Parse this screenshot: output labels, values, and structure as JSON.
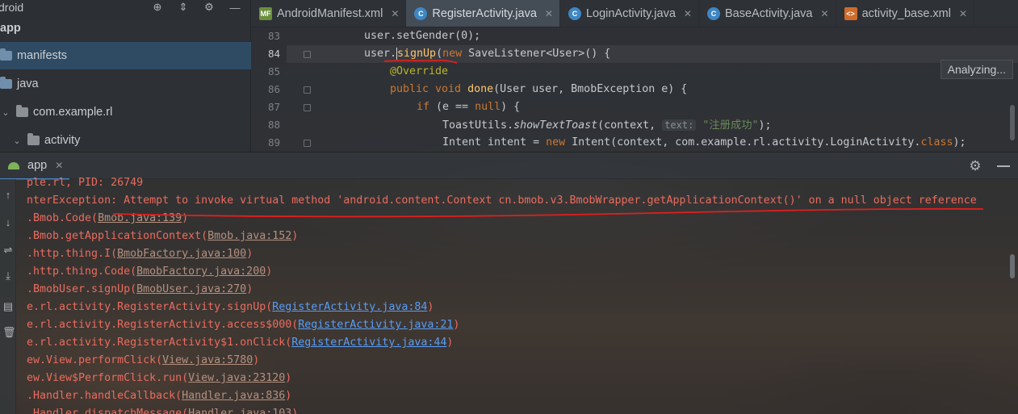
{
  "project": {
    "header": "droid",
    "items": [
      {
        "label": "app",
        "selected": false
      },
      {
        "label": "manifests",
        "selected": true
      },
      {
        "label": "java",
        "selected": false
      },
      {
        "label": "com.example.rl",
        "selected": false
      },
      {
        "label": "activity",
        "selected": false
      }
    ]
  },
  "editor": {
    "tabs": [
      {
        "label": "AndroidManifest.xml",
        "icon": "manifest-icon",
        "active": false
      },
      {
        "label": "RegisterActivity.java",
        "icon": "class-icon",
        "active": true
      },
      {
        "label": "LoginActivity.java",
        "icon": "class-icon",
        "active": false
      },
      {
        "label": "BaseActivity.java",
        "icon": "class-icon",
        "active": false
      },
      {
        "label": "activity_base.xml",
        "icon": "xml-icon",
        "active": false
      }
    ],
    "line_numbers": [
      "83",
      "84",
      "85",
      "86",
      "87",
      "88",
      "89"
    ],
    "current_line": "84",
    "code": {
      "l83": "user.setGender(0);",
      "l84_a": "user.",
      "l84_b": "signUp",
      "l84_c": "(",
      "l84_kw": "new",
      "l84_d": " SaveListener<User>() {",
      "l85": "@Override",
      "l86_kw": "public void",
      "l86_fn": "done",
      "l86_rest": "(User user, BmobException e) {",
      "l87_kw": "if",
      "l87_a": " (e == ",
      "l87_null": "null",
      "l87_b": ") {",
      "l88_a": "ToastUtils.",
      "l88_fn": "showTextToast",
      "l88_b": "(context, ",
      "l88_hint": "text:",
      "l88_str": "\"注册成功\"",
      "l88_c": ");",
      "l89_a": "Intent intent = ",
      "l89_kw": "new",
      "l89_b": " Intent(context, com.example.rl.activity.LoginActivity.",
      "l89_cls": "class",
      "l89_c": ");"
    },
    "status": "Analyzing..."
  },
  "run": {
    "tab_label": "app",
    "lines": [
      {
        "text": "ple.rl, PID: 26749",
        "link": "",
        "after": "",
        "blue": false
      },
      {
        "text": "nterException: Attempt to invoke virtual method 'android.content.Context cn.bmob.v3.BmobWrapper.getApplicationContext()' on a null object reference",
        "link": "",
        "after": "",
        "blue": false
      },
      {
        "text": ".Bmob.Code(",
        "link": "Bmob.java:139",
        "after": ")",
        "blue": false
      },
      {
        "text": ".Bmob.getApplicationContext(",
        "link": "Bmob.java:152",
        "after": ")",
        "blue": false
      },
      {
        "text": ".http.thing.I(",
        "link": "BmobFactory.java:100",
        "after": ")",
        "blue": false
      },
      {
        "text": ".http.thing.Code(",
        "link": "BmobFactory.java:200",
        "after": ")",
        "blue": false
      },
      {
        "text": ".BmobUser.signUp(",
        "link": "BmobUser.java:270",
        "after": ")",
        "blue": false
      },
      {
        "text": "e.rl.activity.RegisterActivity.signUp(",
        "link": "RegisterActivity.java:84",
        "after": ")",
        "blue": true
      },
      {
        "text": "e.rl.activity.RegisterActivity.access$000(",
        "link": "RegisterActivity.java:21",
        "after": ")",
        "blue": true
      },
      {
        "text": "e.rl.activity.RegisterActivity$1.onClick(",
        "link": "RegisterActivity.java:44",
        "after": ")",
        "blue": true
      },
      {
        "text": "ew.View.performClick(",
        "link": "View.java:5780",
        "after": ")",
        "blue": false
      },
      {
        "text": "ew.View$PerformClick.run(",
        "link": "View.java:23120",
        "after": ")",
        "blue": false
      },
      {
        "text": ".Handler.handleCallback(",
        "link": "Handler.java:836",
        "after": ")",
        "blue": false
      },
      {
        "text": ".Handler.dispatchMessage(",
        "link": "Handler.java:103",
        "after": ")",
        "blue": false
      }
    ]
  },
  "colors": {
    "error_text": "#ea6c5e",
    "link_blue": "#589df6",
    "annotation_red": "#e0201c",
    "selection": "#2f4a63"
  }
}
